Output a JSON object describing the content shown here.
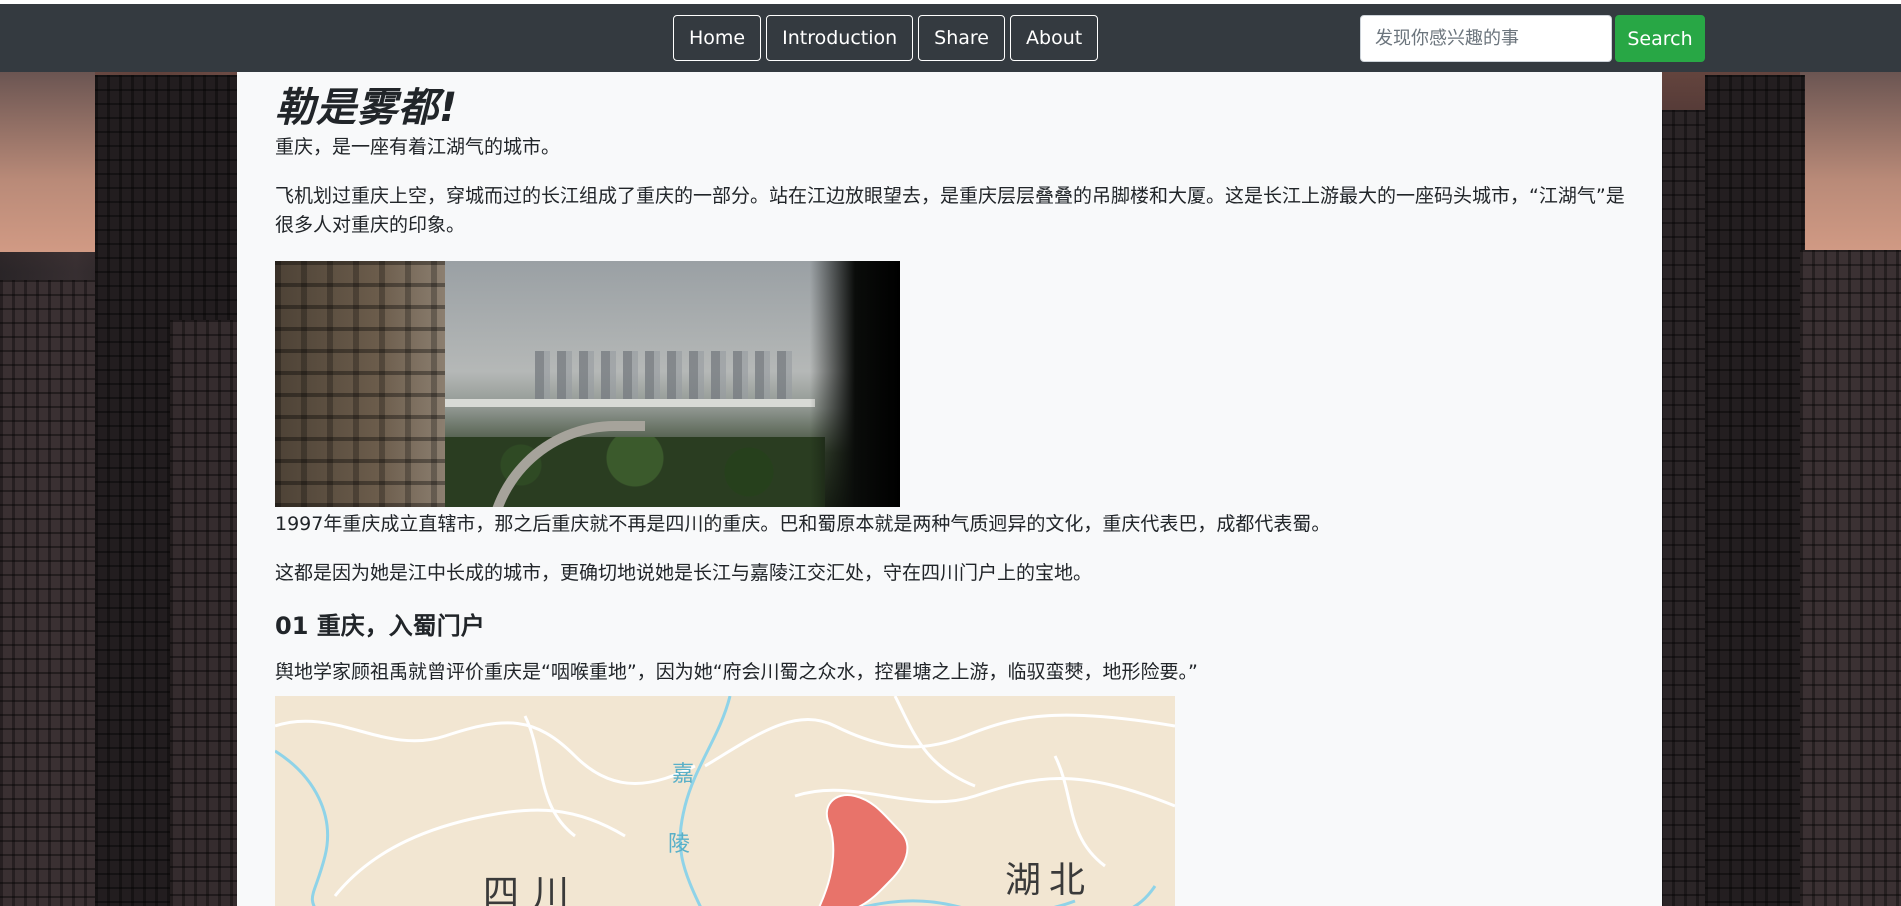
{
  "navbar": {
    "links": [
      "Home",
      "Introduction",
      "Share",
      "About"
    ],
    "search_placeholder": "发现你感兴趣的事",
    "search_button": "Search"
  },
  "article": {
    "title": "勒是雾都!",
    "p1": "重庆，是一座有着江湖气的城市。",
    "p2": "飞机划过重庆上空，穿城而过的长江组成了重庆的一部分。站在江边放眼望去，是重庆层层叠叠的吊脚楼和大厦。这是长江上游最大的一座码头城市，“江湖气”是很多人对重庆的印象。",
    "p3": "1997年重庆成立直辖市，那之后重庆就不再是四川的重庆。巴和蜀原本就是两种气质迥异的文化，重庆代表巴，成都代表蜀。",
    "p4": "这都是因为她是江中长成的城市，更确切地说她是长江与嘉陵江交汇处，守在四川门户上的宝地。",
    "section_heading": "01 重庆，入蜀门户",
    "p5": "舆地学家顾祖禹就曾评价重庆是“咽喉重地”，因为她“府会川蜀之众水，控瞿塘之上游，临驭蛮僰，地形险要。”"
  },
  "map": {
    "label_sichuan": "四川",
    "label_hubei": "湖北",
    "river_char_1": "嘉",
    "river_char_2": "陵"
  }
}
